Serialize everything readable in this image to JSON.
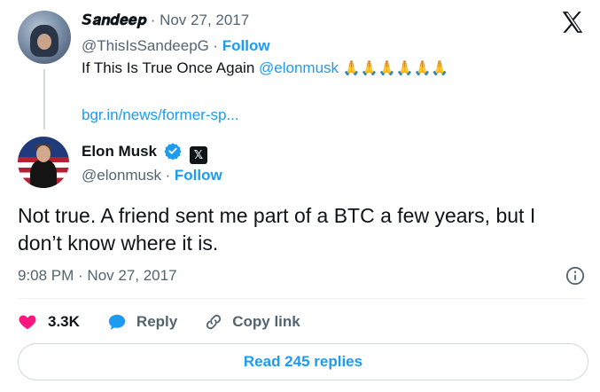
{
  "reply_tweet": {
    "author_name": "𝙎𝒂𝒏𝒅𝒆𝒆𝒑",
    "date": "Nov 27, 2017",
    "handle": "@ThisIsSandeepG",
    "follow_label": "Follow",
    "text_before": "If This Is True Once Again ",
    "mention": "@elonmusk",
    "emoji": "🙏🙏🙏🙏🙏🙏",
    "link": "bgr.in/news/former-sp..."
  },
  "main_tweet": {
    "author_name": "Elon Musk",
    "handle": "@elonmusk",
    "follow_label": "Follow",
    "text": "Not true. A friend sent me part of a BTC a few years, but I don’t know where it is.",
    "timestamp": "9:08 PM · Nov 27, 2017"
  },
  "actions": {
    "like_count": "3.3K",
    "reply_label": "Reply",
    "copy_link_label": "Copy link"
  },
  "read_replies_label": "Read 245 replies",
  "colors": {
    "accent": "#1d9bf0",
    "like": "#f91880",
    "muted": "#536471"
  },
  "icons": [
    "x-logo-icon",
    "verified-badge-icon",
    "x-affiliate-badge-icon",
    "info-icon",
    "heart-icon",
    "reply-bubble-icon",
    "link-icon"
  ]
}
